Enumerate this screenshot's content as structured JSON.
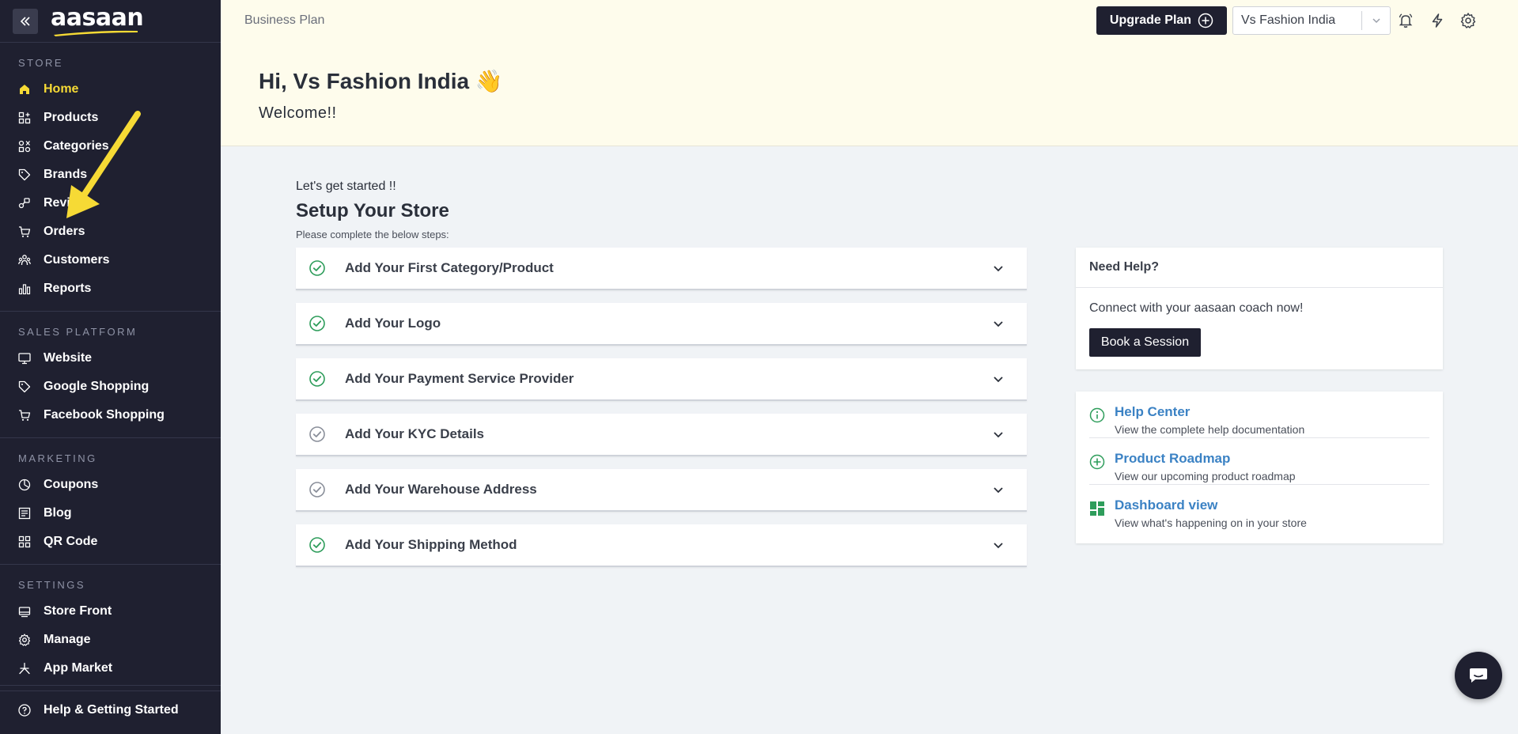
{
  "app": {
    "logo_text": "aasaan"
  },
  "sidebar": {
    "sections": [
      {
        "title": "STORE",
        "items": [
          {
            "label": "Home",
            "icon": "home-icon",
            "active": true
          },
          {
            "label": "Products",
            "icon": "products-icon"
          },
          {
            "label": "Categories",
            "icon": "categories-icon"
          },
          {
            "label": "Brands",
            "icon": "tag-icon"
          },
          {
            "label": "Reviews",
            "icon": "reviews-icon"
          },
          {
            "label": "Orders",
            "icon": "cart-icon"
          },
          {
            "label": "Customers",
            "icon": "customers-icon"
          },
          {
            "label": "Reports",
            "icon": "bar-chart-icon"
          }
        ]
      },
      {
        "title": "SALES PLATFORM",
        "items": [
          {
            "label": "Website",
            "icon": "monitor-icon"
          },
          {
            "label": "Google Shopping",
            "icon": "tag-icon"
          },
          {
            "label": "Facebook Shopping",
            "icon": "cart-icon"
          }
        ]
      },
      {
        "title": "MARKETING",
        "items": [
          {
            "label": "Coupons",
            "icon": "coupon-icon"
          },
          {
            "label": "Blog",
            "icon": "blog-icon"
          },
          {
            "label": "QR Code",
            "icon": "qr-code-icon"
          }
        ]
      },
      {
        "title": "SETTINGS",
        "items": [
          {
            "label": "Store Front",
            "icon": "store-front-icon"
          },
          {
            "label": "Manage",
            "icon": "gear-icon"
          },
          {
            "label": "App Market",
            "icon": "app-market-icon"
          }
        ]
      }
    ],
    "footer_label": "Help & Getting Started"
  },
  "header": {
    "plan_label": "Business Plan",
    "upgrade_label": "Upgrade Plan",
    "store_selected": "Vs Fashion India",
    "greeting": "Hi, Vs Fashion India 👋",
    "welcome": "Welcome!!"
  },
  "setup": {
    "intro": "Let's get started !!",
    "title": "Setup Your Store",
    "subtitle": "Please complete the below steps:",
    "steps": [
      {
        "label": "Add Your First Category/Product",
        "done": true
      },
      {
        "label": "Add Your Logo",
        "done": true
      },
      {
        "label": "Add Your Payment Service Provider",
        "done": true
      },
      {
        "label": "Add Your KYC Details",
        "done": false
      },
      {
        "label": "Add Your Warehouse Address",
        "done": false
      },
      {
        "label": "Add Your Shipping Method",
        "done": true
      }
    ]
  },
  "help": {
    "title": "Need Help?",
    "text": "Connect with your aasaan coach now!",
    "button": "Book a Session",
    "links": [
      {
        "title": "Help Center",
        "desc": "View the complete help documentation",
        "icon": "info-icon"
      },
      {
        "title": "Product Roadmap",
        "desc": "View our upcoming product roadmap",
        "icon": "plus-circle-icon"
      },
      {
        "title": "Dashboard view",
        "desc": "View what's happening on in your store",
        "icon": "dashboard-icon"
      }
    ]
  },
  "colors": {
    "sidebar_bg": "#1f2030",
    "active": "#f6da35",
    "check_done": "#2e9d5b",
    "check_pending": "#8a8f9a",
    "link": "#3b82c4",
    "header_bg": "#fefcec"
  }
}
